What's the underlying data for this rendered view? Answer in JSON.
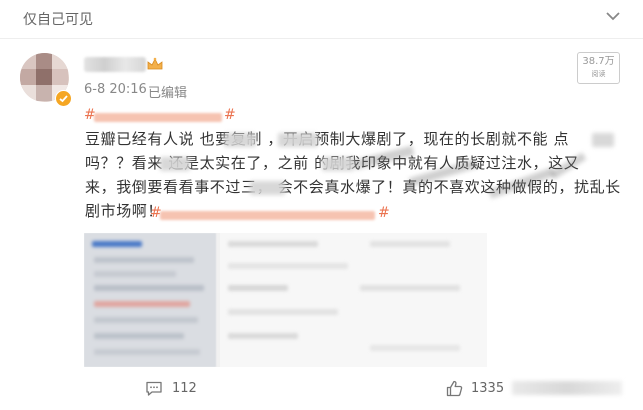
{
  "header": {
    "visibility": "仅自己可见"
  },
  "post": {
    "timestamp": "6-8 20:16",
    "edited": "已编辑",
    "views": {
      "count": "38.7万",
      "label": "阅读"
    },
    "body_lines": [
      "豆瓣已经有人说    也要复制     ，开启预制大爆剧了，现在的长剧就不能    点",
      "吗？？看来    还是太实在了，之前    的剧我印象中就有人质疑过注水，这又",
      "来，我倒要看看事不过三，    会不会真水爆了！真的不喜欢这种做假的，扰乱长",
      "剧市场啊！"
    ]
  },
  "footer": {
    "comments": "112",
    "likes": "1335"
  },
  "colors": {
    "topic": "#eb7350",
    "verified": "#f5a623"
  }
}
